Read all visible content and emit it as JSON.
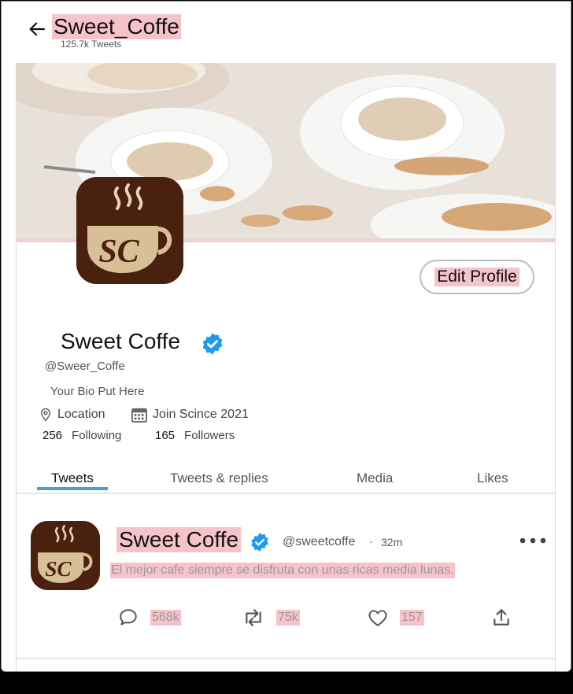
{
  "header": {
    "title": "Sweet_Coffe",
    "tweet_count": "125.7k Tweets"
  },
  "profile": {
    "edit_button": "Edit Profile",
    "name": "Sweet Coffe",
    "handle": "@Sweer_Coffe",
    "bio": "Your Bio Put Here",
    "location": "Location",
    "joined": "Join Scince 2021",
    "following_count": "256",
    "following_label": "Following",
    "followers_count": "165",
    "followers_label": "Followers",
    "avatar_text": "SC"
  },
  "tabs": [
    {
      "label": "Tweets",
      "active": true
    },
    {
      "label": "Tweets & replies",
      "active": false
    },
    {
      "label": "Media",
      "active": false
    },
    {
      "label": "Likes",
      "active": false
    }
  ],
  "tweet": {
    "name": "Sweet Coffe",
    "handle": "@sweetcoffe",
    "separator": "·",
    "time": "32m",
    "text": "El mejor cafe siempre se disfruta con unas ricas media lunas.",
    "replies": "568k",
    "retweets": "75k",
    "likes": "157"
  },
  "colors": {
    "accent": "#4a9de0",
    "verified": "#1d9bf0",
    "highlight": "#f7c3cb",
    "logo_bg": "#4a200e"
  },
  "icons": {
    "back": "arrow-left-icon",
    "verified": "verified-badge-icon",
    "location": "location-pin-icon",
    "calendar": "calendar-icon",
    "reply": "comment-icon",
    "retweet": "retweet-icon",
    "like": "heart-icon",
    "share": "share-icon",
    "more": "more-dots-icon"
  }
}
